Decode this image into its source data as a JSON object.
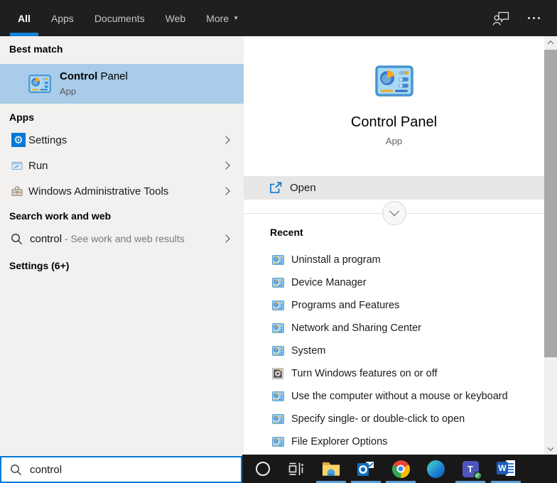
{
  "topbar": {
    "tabs": [
      {
        "label": "All",
        "active": true
      },
      {
        "label": "Apps",
        "active": false
      },
      {
        "label": "Documents",
        "active": false
      },
      {
        "label": "Web",
        "active": false
      },
      {
        "label": "More",
        "active": false,
        "dropdown": true
      }
    ],
    "right_icons": [
      "user-feedback-icon",
      "ellipsis-icon"
    ]
  },
  "left_panel": {
    "best_match_header": "Best match",
    "best_match": {
      "title_bold": "Control",
      "title_regular": " Panel",
      "subtitle": "App",
      "icon": "control-panel-icon"
    },
    "apps_header": "Apps",
    "app_items": [
      {
        "label": "Settings",
        "icon": "settings-gear-icon"
      },
      {
        "label": "Run",
        "icon": "run-window-icon"
      },
      {
        "label": "Windows Administrative Tools",
        "icon": "admin-tools-icon"
      }
    ],
    "search_web_header": "Search work and web",
    "search_web_item": {
      "query": "control",
      "suffix": " - See work and web results",
      "icon": "search-icon"
    },
    "settings_group_header": "Settings (6+)"
  },
  "right_panel": {
    "app_title": "Control Panel",
    "app_subtitle": "App",
    "app_icon": "control-panel-icon",
    "open_label": "Open",
    "open_icon": "open-external-icon",
    "expander_icon": "chevron-down-icon",
    "recent_header": "Recent",
    "recent_items": [
      {
        "label": "Uninstall a program",
        "icon": "control-panel-small-icon"
      },
      {
        "label": "Device Manager",
        "icon": "control-panel-small-icon"
      },
      {
        "label": "Programs and Features",
        "icon": "control-panel-small-icon"
      },
      {
        "label": "Network and Sharing Center",
        "icon": "control-panel-small-icon"
      },
      {
        "label": "System",
        "icon": "control-panel-small-icon"
      },
      {
        "label": "Turn Windows features on or off",
        "icon": "windows-features-icon"
      },
      {
        "label": "Use the computer without a mouse or keyboard",
        "icon": "control-panel-small-icon"
      },
      {
        "label": "Specify single- or double-click to open",
        "icon": "control-panel-small-icon"
      },
      {
        "label": "File Explorer Options",
        "icon": "control-panel-small-icon"
      }
    ]
  },
  "search_bar": {
    "value": "control",
    "icon": "search-icon"
  },
  "taskbar": {
    "items": [
      {
        "name": "cortana",
        "running": false
      },
      {
        "name": "task-view",
        "running": false
      },
      {
        "name": "file-explorer",
        "running": true
      },
      {
        "name": "outlook",
        "running": true
      },
      {
        "name": "chrome",
        "running": true
      },
      {
        "name": "edge",
        "running": false
      },
      {
        "name": "teams",
        "running": true
      },
      {
        "name": "word",
        "running": true
      }
    ]
  },
  "colors": {
    "accent": "#0078d7",
    "tab_underline": "#1283d8",
    "best_match_highlight": "#a8cce9",
    "open_row_bg": "#e6e6e6",
    "taskbar_indicator": "#5f9fd8"
  }
}
